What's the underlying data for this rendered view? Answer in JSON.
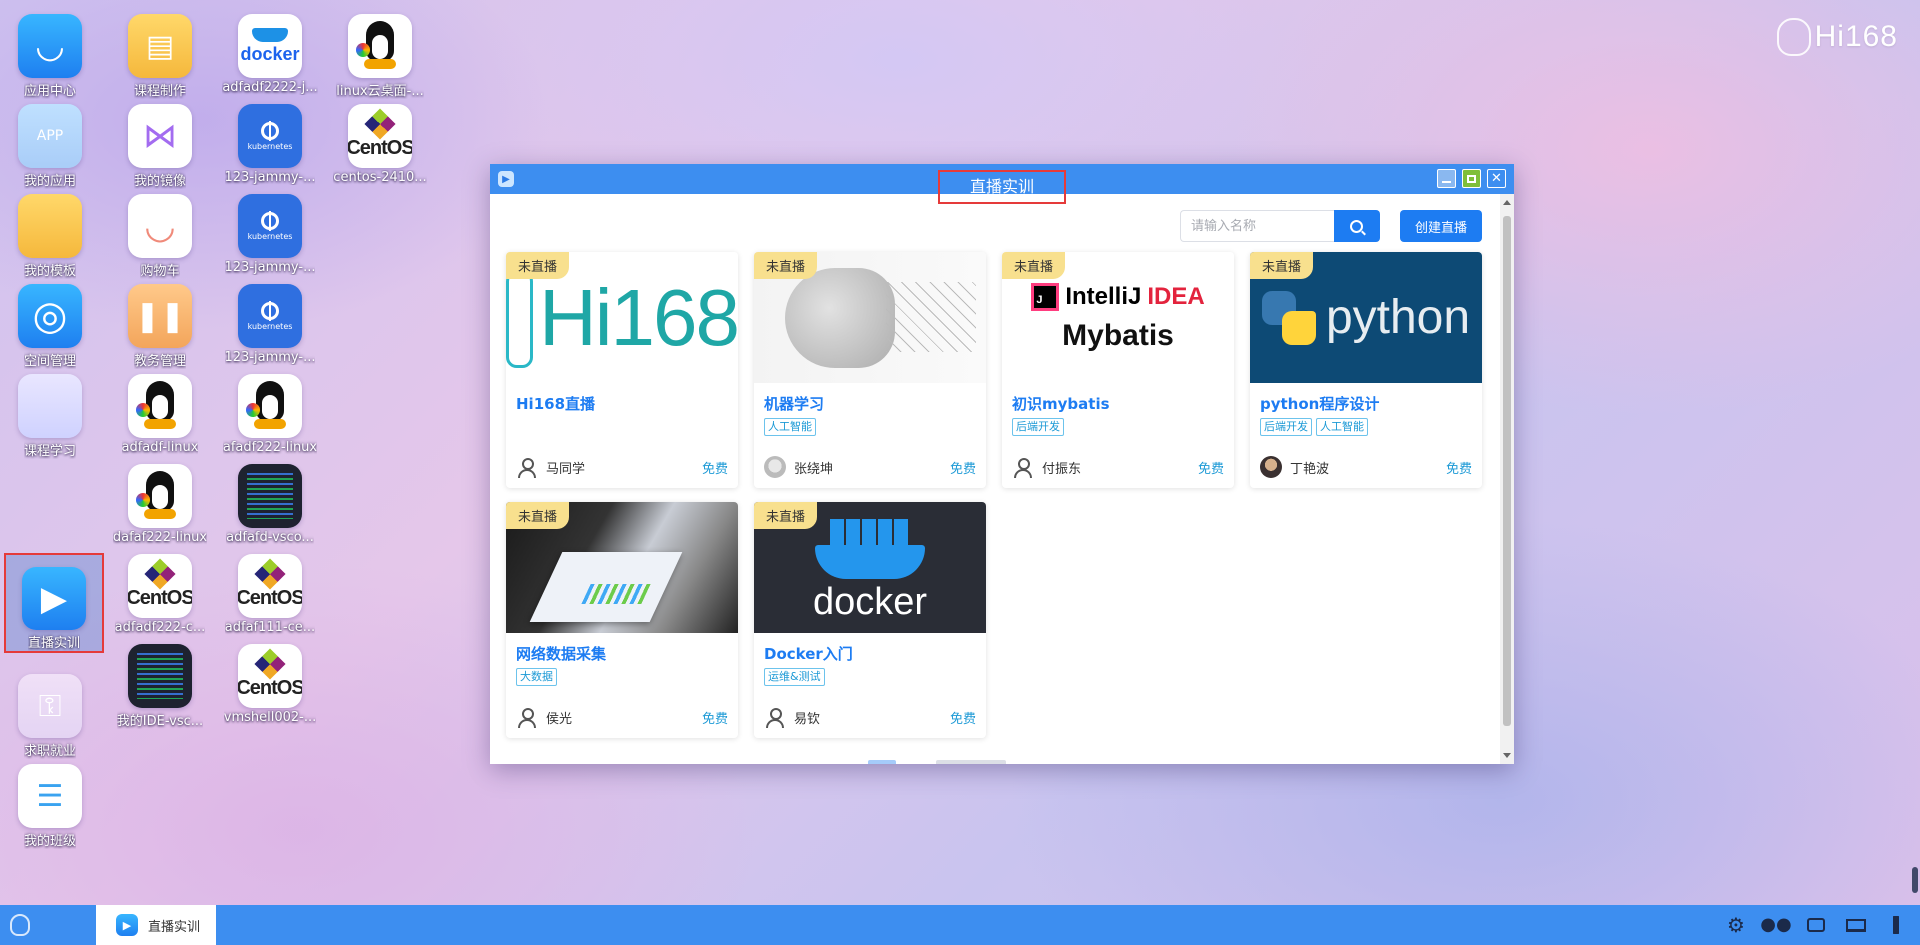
{
  "brand": {
    "logo_text": "Hi168"
  },
  "desktop_icons": [
    {
      "label": "应用中心",
      "icon": "app-store-icon"
    },
    {
      "label": "我的应用",
      "icon": "app-icon",
      "glyph": "APP"
    },
    {
      "label": "我的模板",
      "icon": "folder-icon"
    },
    {
      "label": "空间管理",
      "icon": "space-manage-icon"
    },
    {
      "label": "课程学习",
      "icon": "course-study-icon"
    },
    {
      "label": "直播实训",
      "icon": "live-play-icon"
    },
    {
      "label": "求职就业",
      "icon": "key-icon"
    },
    {
      "label": "我的班级",
      "icon": "class-list-icon"
    },
    {
      "label": "课程制作",
      "icon": "document-icon"
    },
    {
      "label": "我的镜像",
      "icon": "mirror-icon"
    },
    {
      "label": "购物车",
      "icon": "cart-icon"
    },
    {
      "label": "教务管理",
      "icon": "academic-icon"
    },
    {
      "label": "adfadf-linux",
      "icon": "linux-tux-icon"
    },
    {
      "label": "dafaf222-linux",
      "icon": "linux-tux-icon"
    },
    {
      "label": "adfadf222-c...",
      "icon": "centos-icon"
    },
    {
      "label": "我的IDE-vsc...",
      "icon": "code-editor-icon"
    },
    {
      "label": "adfadf2222-j...",
      "icon": "docker-icon"
    },
    {
      "label": "123-jammy-...",
      "icon": "kubernetes-icon"
    },
    {
      "label": "123-jammy-...",
      "icon": "kubernetes-icon"
    },
    {
      "label": "123-jammy-...",
      "icon": "kubernetes-icon"
    },
    {
      "label": "afadf222-linux",
      "icon": "linux-tux-icon"
    },
    {
      "label": "adfafd-vsco...",
      "icon": "code-editor-icon"
    },
    {
      "label": "adfaf111-ce...",
      "icon": "centos-icon"
    },
    {
      "label": "vmshell002-...",
      "icon": "centos-icon"
    },
    {
      "label": "linux云桌面-...",
      "icon": "linux-tux-icon"
    },
    {
      "label": "centos-2410...",
      "icon": "centos-icon"
    }
  ],
  "window": {
    "title": "直播实训",
    "search": {
      "placeholder": "请输入名称",
      "value": ""
    },
    "create_button": "创建直播",
    "courses": [
      {
        "cover": "Hi168",
        "badge": "未直播",
        "title": "Hi168直播",
        "tags": [],
        "teacher": "马同学",
        "price": "免费"
      },
      {
        "cover": "machine-learning",
        "badge": "未直播",
        "title": "机器学习",
        "tags": [
          "人工智能"
        ],
        "teacher": "张绕坤",
        "price": "免费"
      },
      {
        "cover": "IntelliJ IDEA Mybatis",
        "cover_line1_a": "IntelliJ",
        "cover_line1_b": "IDEA",
        "cover_line2": "Mybatis",
        "badge": "未直播",
        "title": "初识mybatis",
        "tags": [
          "后端开发"
        ],
        "teacher": "付振东",
        "price": "免费"
      },
      {
        "cover": "python",
        "badge": "未直播",
        "title": "python程序设计",
        "tags": [
          "后端开发",
          "人工智能"
        ],
        "teacher": "丁艳波",
        "price": "免费"
      },
      {
        "cover": "data-collection",
        "badge": "未直播",
        "title": "网络数据采集",
        "tags": [
          "大数据"
        ],
        "teacher": "侯光",
        "price": "免费"
      },
      {
        "cover": "docker",
        "badge": "未直播",
        "title": "Docker入门",
        "tags": [
          "运维&测试"
        ],
        "teacher": "易钦",
        "price": "免费"
      }
    ]
  },
  "taskbar": {
    "active_task": {
      "label": "直播实训",
      "icon": "live-play-icon"
    },
    "tray_icons": [
      "settings-icon",
      "wechat-icon",
      "chat-icon",
      "monitor-icon",
      "scroll-handle-icon"
    ]
  },
  "colors": {
    "accent": "#1d7cf2",
    "titlebar": "#3d8ef0",
    "badge": "#f8e08e",
    "tag": "#1d9ad6",
    "highlight": "#e53a3a"
  }
}
